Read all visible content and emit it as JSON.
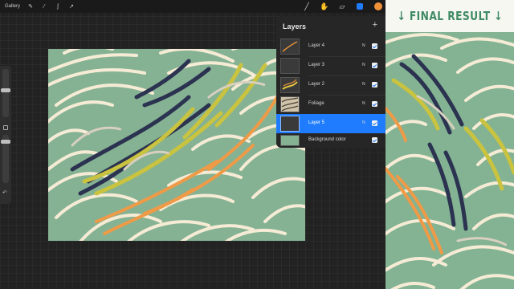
{
  "topbar": {
    "gallery_label": "Gallery",
    "left_icons": [
      "wrench-icon",
      "magic-wand-icon",
      "selection-s-icon",
      "transform-arrow-icon"
    ],
    "right_icons": [
      "brush-icon",
      "smudge-icon",
      "eraser-icon",
      "layers-icon",
      "color-picker-icon"
    ],
    "active_color": "#f0913a",
    "layers_accent": "#1f7cff"
  },
  "sidebar": {
    "undo_symbol": "↶"
  },
  "layers_panel": {
    "title": "Layers",
    "add_symbol": "+",
    "layers": [
      {
        "name": "Layer 4",
        "blend": "N",
        "visible": true,
        "selected": false
      },
      {
        "name": "Layer 3",
        "blend": "N",
        "visible": true,
        "selected": false
      },
      {
        "name": "Layer 2",
        "blend": "N",
        "visible": true,
        "selected": false
      },
      {
        "name": "Foliage",
        "blend": "N",
        "visible": true,
        "selected": false
      },
      {
        "name": "Layer 5",
        "blend": "N",
        "visible": true,
        "selected": true
      },
      {
        "name": "Background color",
        "blend": "",
        "visible": true,
        "selected": false
      }
    ]
  },
  "final_result": {
    "title": "↓ FINAL RESULT ↓"
  },
  "colors": {
    "canvas_bg": "#86b294",
    "leaf_cream": "#f6ecd6",
    "navy": "#2b3350",
    "yellow": "#c9c33f",
    "orange": "#ef9a46",
    "green_title": "#3e8a63"
  }
}
